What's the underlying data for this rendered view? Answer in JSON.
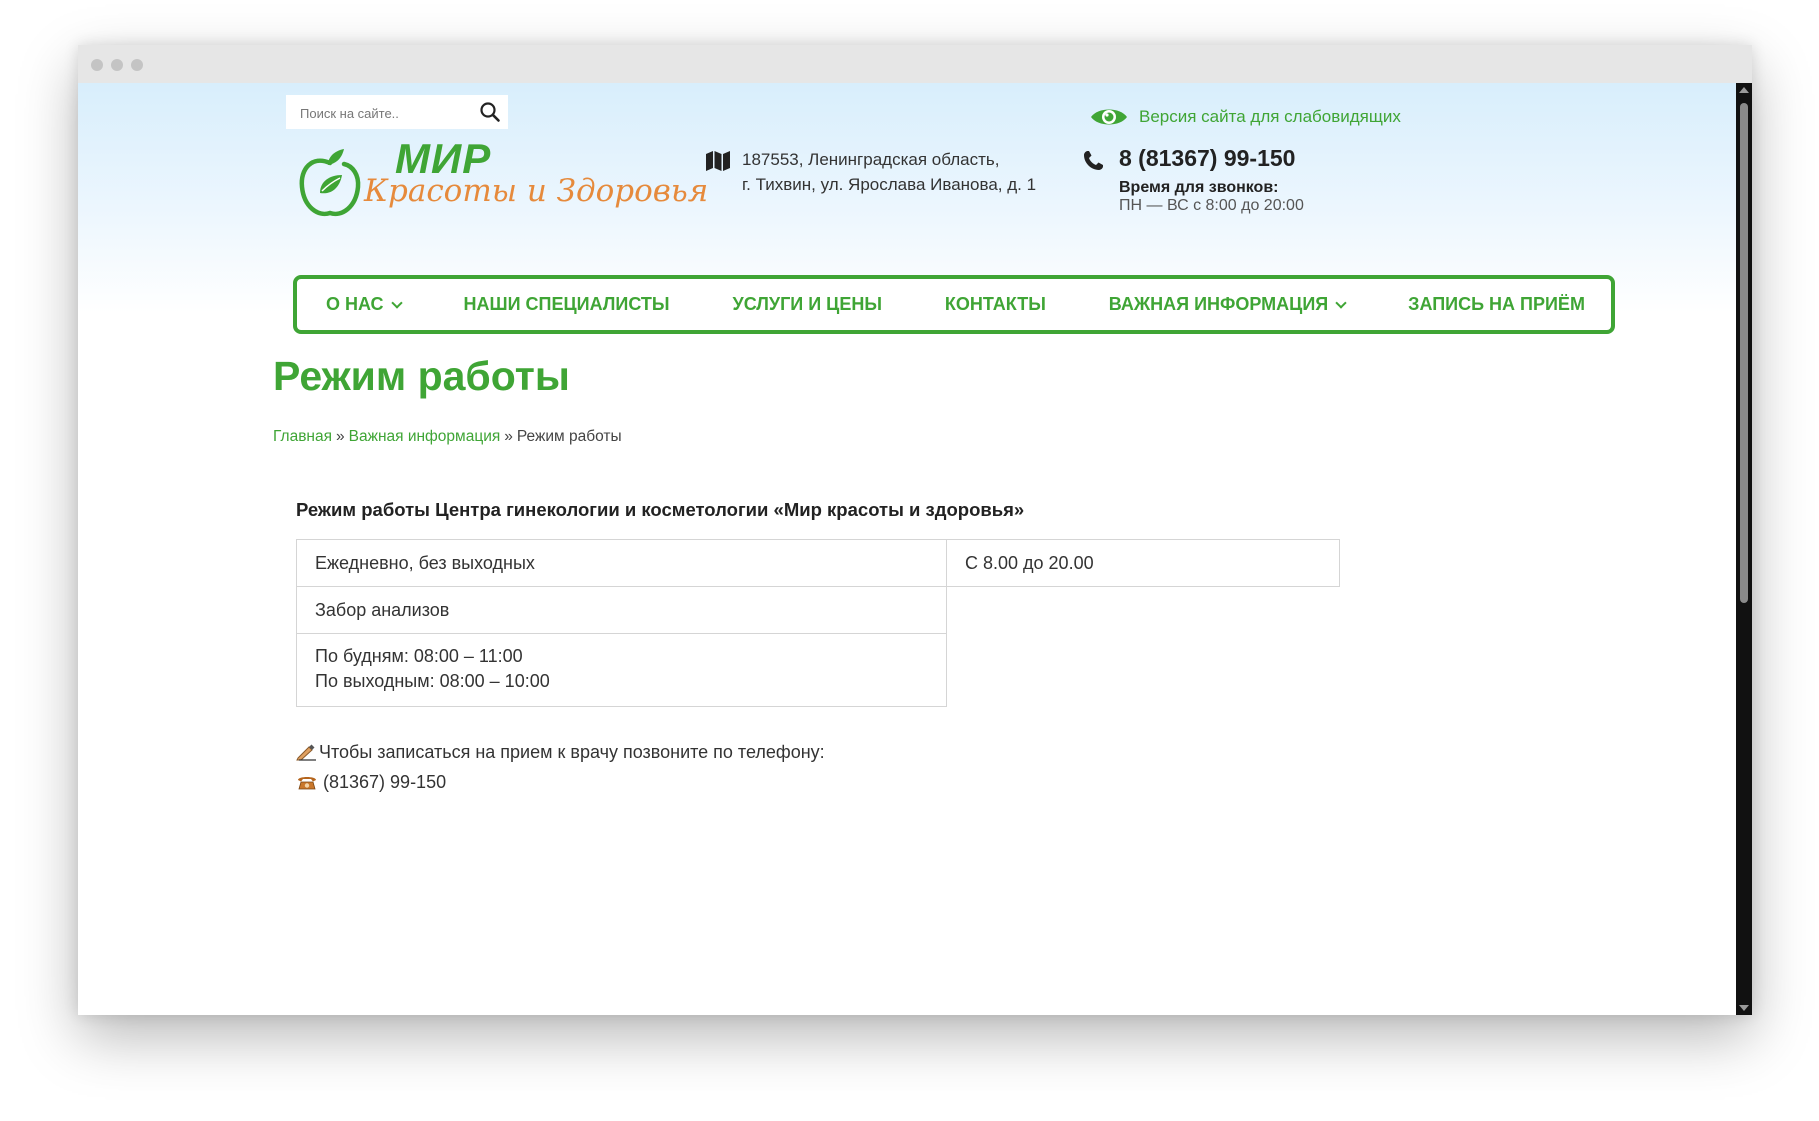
{
  "search": {
    "placeholder": "Поиск на сайте.."
  },
  "accessibility": {
    "label": "Версия сайта для слабовидящих"
  },
  "logo": {
    "line1": "МИР",
    "line2": "Красоты и Здоровья"
  },
  "address": {
    "line1": "187553, Ленинградская область,",
    "line2": "г. Тихвин, ул. Ярослава Иванова, д. 1"
  },
  "contact": {
    "phone": "8 (81367) 99-150",
    "hours_title": "Время для звонков:",
    "hours": "ПН — ВС с 8:00 до 20:00"
  },
  "nav": [
    {
      "label": "О нас",
      "has_dropdown": true
    },
    {
      "label": "Наши специалисты"
    },
    {
      "label": "Услуги и цены"
    },
    {
      "label": "Контакты"
    },
    {
      "label": "Важная информация",
      "has_dropdown": true
    },
    {
      "label": "Запись на приём"
    }
  ],
  "page": {
    "title": "Режим работы",
    "breadcrumb": [
      "Главная",
      "Важная информация",
      "Режим работы"
    ],
    "breadcrumb_separator": "»"
  },
  "content": {
    "heading": "Режим работы Центра гинекологии и косметологии «Мир красоты и здоровья»",
    "table": {
      "row1": [
        "Ежедневно, без выходных",
        "С 8.00 до 20.00"
      ],
      "row2": "Забор анализов",
      "row3": [
        "По будням: 08:00 – 11:00",
        "По выходным: 08:00 – 10:00"
      ]
    },
    "note_line1": "Чтобы записаться на прием к врачу позвоните по телефону:",
    "note_line2": "(81367) 99-150"
  },
  "colors": {
    "brand_green": "#3fa535",
    "brand_orange": "#e68a3c"
  }
}
